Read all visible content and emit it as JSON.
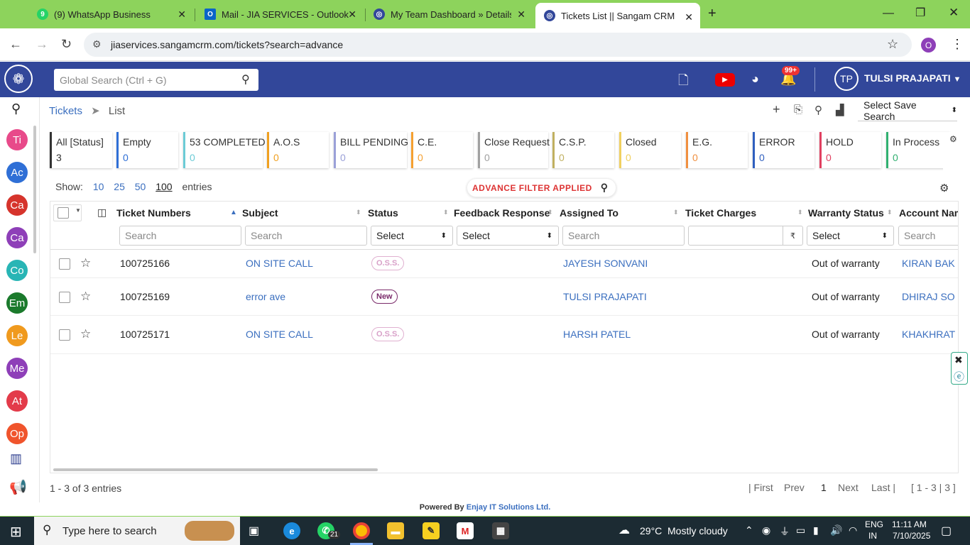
{
  "browser": {
    "tabs": [
      {
        "title": "(9) WhatsApp Business",
        "active": false
      },
      {
        "title": "Mail - JIA SERVICES - Outlook",
        "active": false
      },
      {
        "title": "My Team Dashboard » Details ||",
        "active": false
      },
      {
        "title": "Tickets List || Sangam CRM",
        "active": true
      }
    ],
    "url": "jiaservices.sangamcrm.com/tickets?search=advance",
    "profile_initial": "O"
  },
  "header": {
    "search_placeholder": "Global Search (Ctrl + G)",
    "notification_count": "99+",
    "user_initials": "TP",
    "user_name": "TULSI PRAJAPATI"
  },
  "sidebar": {
    "items": [
      {
        "label": "Ti",
        "color": "#e84a8a"
      },
      {
        "label": "Ac",
        "color": "#2f6fd6"
      },
      {
        "label": "Ca",
        "color": "#d6342c"
      },
      {
        "label": "Ca",
        "color": "#8e3fb8"
      },
      {
        "label": "Co",
        "color": "#28b5b5"
      },
      {
        "label": "Em",
        "color": "#1b7a2c"
      },
      {
        "label": "Le",
        "color": "#f09a1e"
      },
      {
        "label": "Me",
        "color": "#8e3fb8"
      },
      {
        "label": "At",
        "color": "#e33b4a"
      },
      {
        "label": "Op",
        "color": "#f0542c"
      }
    ]
  },
  "breadcrumb": {
    "root": "Tickets",
    "sep": "➤",
    "current": "List"
  },
  "toolbar": {
    "save_search": "Select Save Search"
  },
  "status_cards": [
    {
      "name": "All [Status]",
      "count": "3",
      "color": "#333333"
    },
    {
      "name": "Empty",
      "count": "0",
      "color": "#2f6fd6"
    },
    {
      "name": "53 COMPLETED",
      "count": "0",
      "color": "#6ccbd6"
    },
    {
      "name": "A.O.S",
      "count": "0",
      "color": "#f0a020"
    },
    {
      "name": "BILL PENDING",
      "count": "0",
      "color": "#9aa0d8"
    },
    {
      "name": "C.E.",
      "count": "0",
      "color": "#f5a030"
    },
    {
      "name": "Close Request",
      "count": "0",
      "color": "#a0a0a0"
    },
    {
      "name": "C.S.P.",
      "count": "0",
      "color": "#c0b060"
    },
    {
      "name": "Closed",
      "count": "0",
      "color": "#f0d060"
    },
    {
      "name": "E.G.",
      "count": "0",
      "color": "#f09040"
    },
    {
      "name": "ERROR",
      "count": "0",
      "color": "#2f5fbf"
    },
    {
      "name": "HOLD",
      "count": "0",
      "color": "#e04060"
    },
    {
      "name": "In Process",
      "count": "0",
      "color": "#30b070"
    }
  ],
  "show": {
    "label": "Show:",
    "options": [
      "10",
      "25",
      "50",
      "100"
    ],
    "selected": "100",
    "suffix": "entries"
  },
  "advance_filter": "ADVANCE FILTER APPLIED",
  "table": {
    "columns": [
      "Ticket Numbers",
      "Subject",
      "Status",
      "Feedback Response",
      "Assigned To",
      "Ticket Charges",
      "Warranty Status",
      "Account Nam"
    ],
    "filters": {
      "ticket": "Search",
      "subject": "Search",
      "status": "Select",
      "feedback": "Select",
      "assigned": "Search",
      "charges_symbol": "₹",
      "warranty": "Select",
      "account": "Search"
    },
    "rows": [
      {
        "number": "100725166",
        "subject": "ON SITE CALL",
        "status": "O.S.S.",
        "assigned": "JAYESH SONVANI",
        "warranty": "Out of warranty",
        "account": "KIRAN BAK"
      },
      {
        "number": "100725169",
        "subject": "error ave",
        "status": "New",
        "assigned": "TULSI PRAJAPATI",
        "warranty": "Out of warranty",
        "account": "DHIRAJ SO"
      },
      {
        "number": "100725171",
        "subject": "ON SITE CALL",
        "status": "O.S.S.",
        "assigned": "HARSH PATEL",
        "warranty": "Out of warranty",
        "account": "KHAKHRAT"
      }
    ]
  },
  "footer": {
    "entries": "1 - 3 of 3 entries",
    "first": "| First",
    "prev": "Prev",
    "page": "1",
    "next": "Next",
    "last": "Last |",
    "range": "[ 1 - 3 | 3 ]",
    "powered_prefix": "Powered By",
    "powered_company": "Enjay IT Solutions Ltd."
  },
  "taskbar": {
    "search_placeholder": "Type here to search",
    "whatsapp_badge": "21",
    "weather_temp": "29°C",
    "weather_text": "Mostly cloudy",
    "lang": "ENG",
    "region": "IN",
    "time": "11:11 AM",
    "date": "7/10/2025"
  }
}
